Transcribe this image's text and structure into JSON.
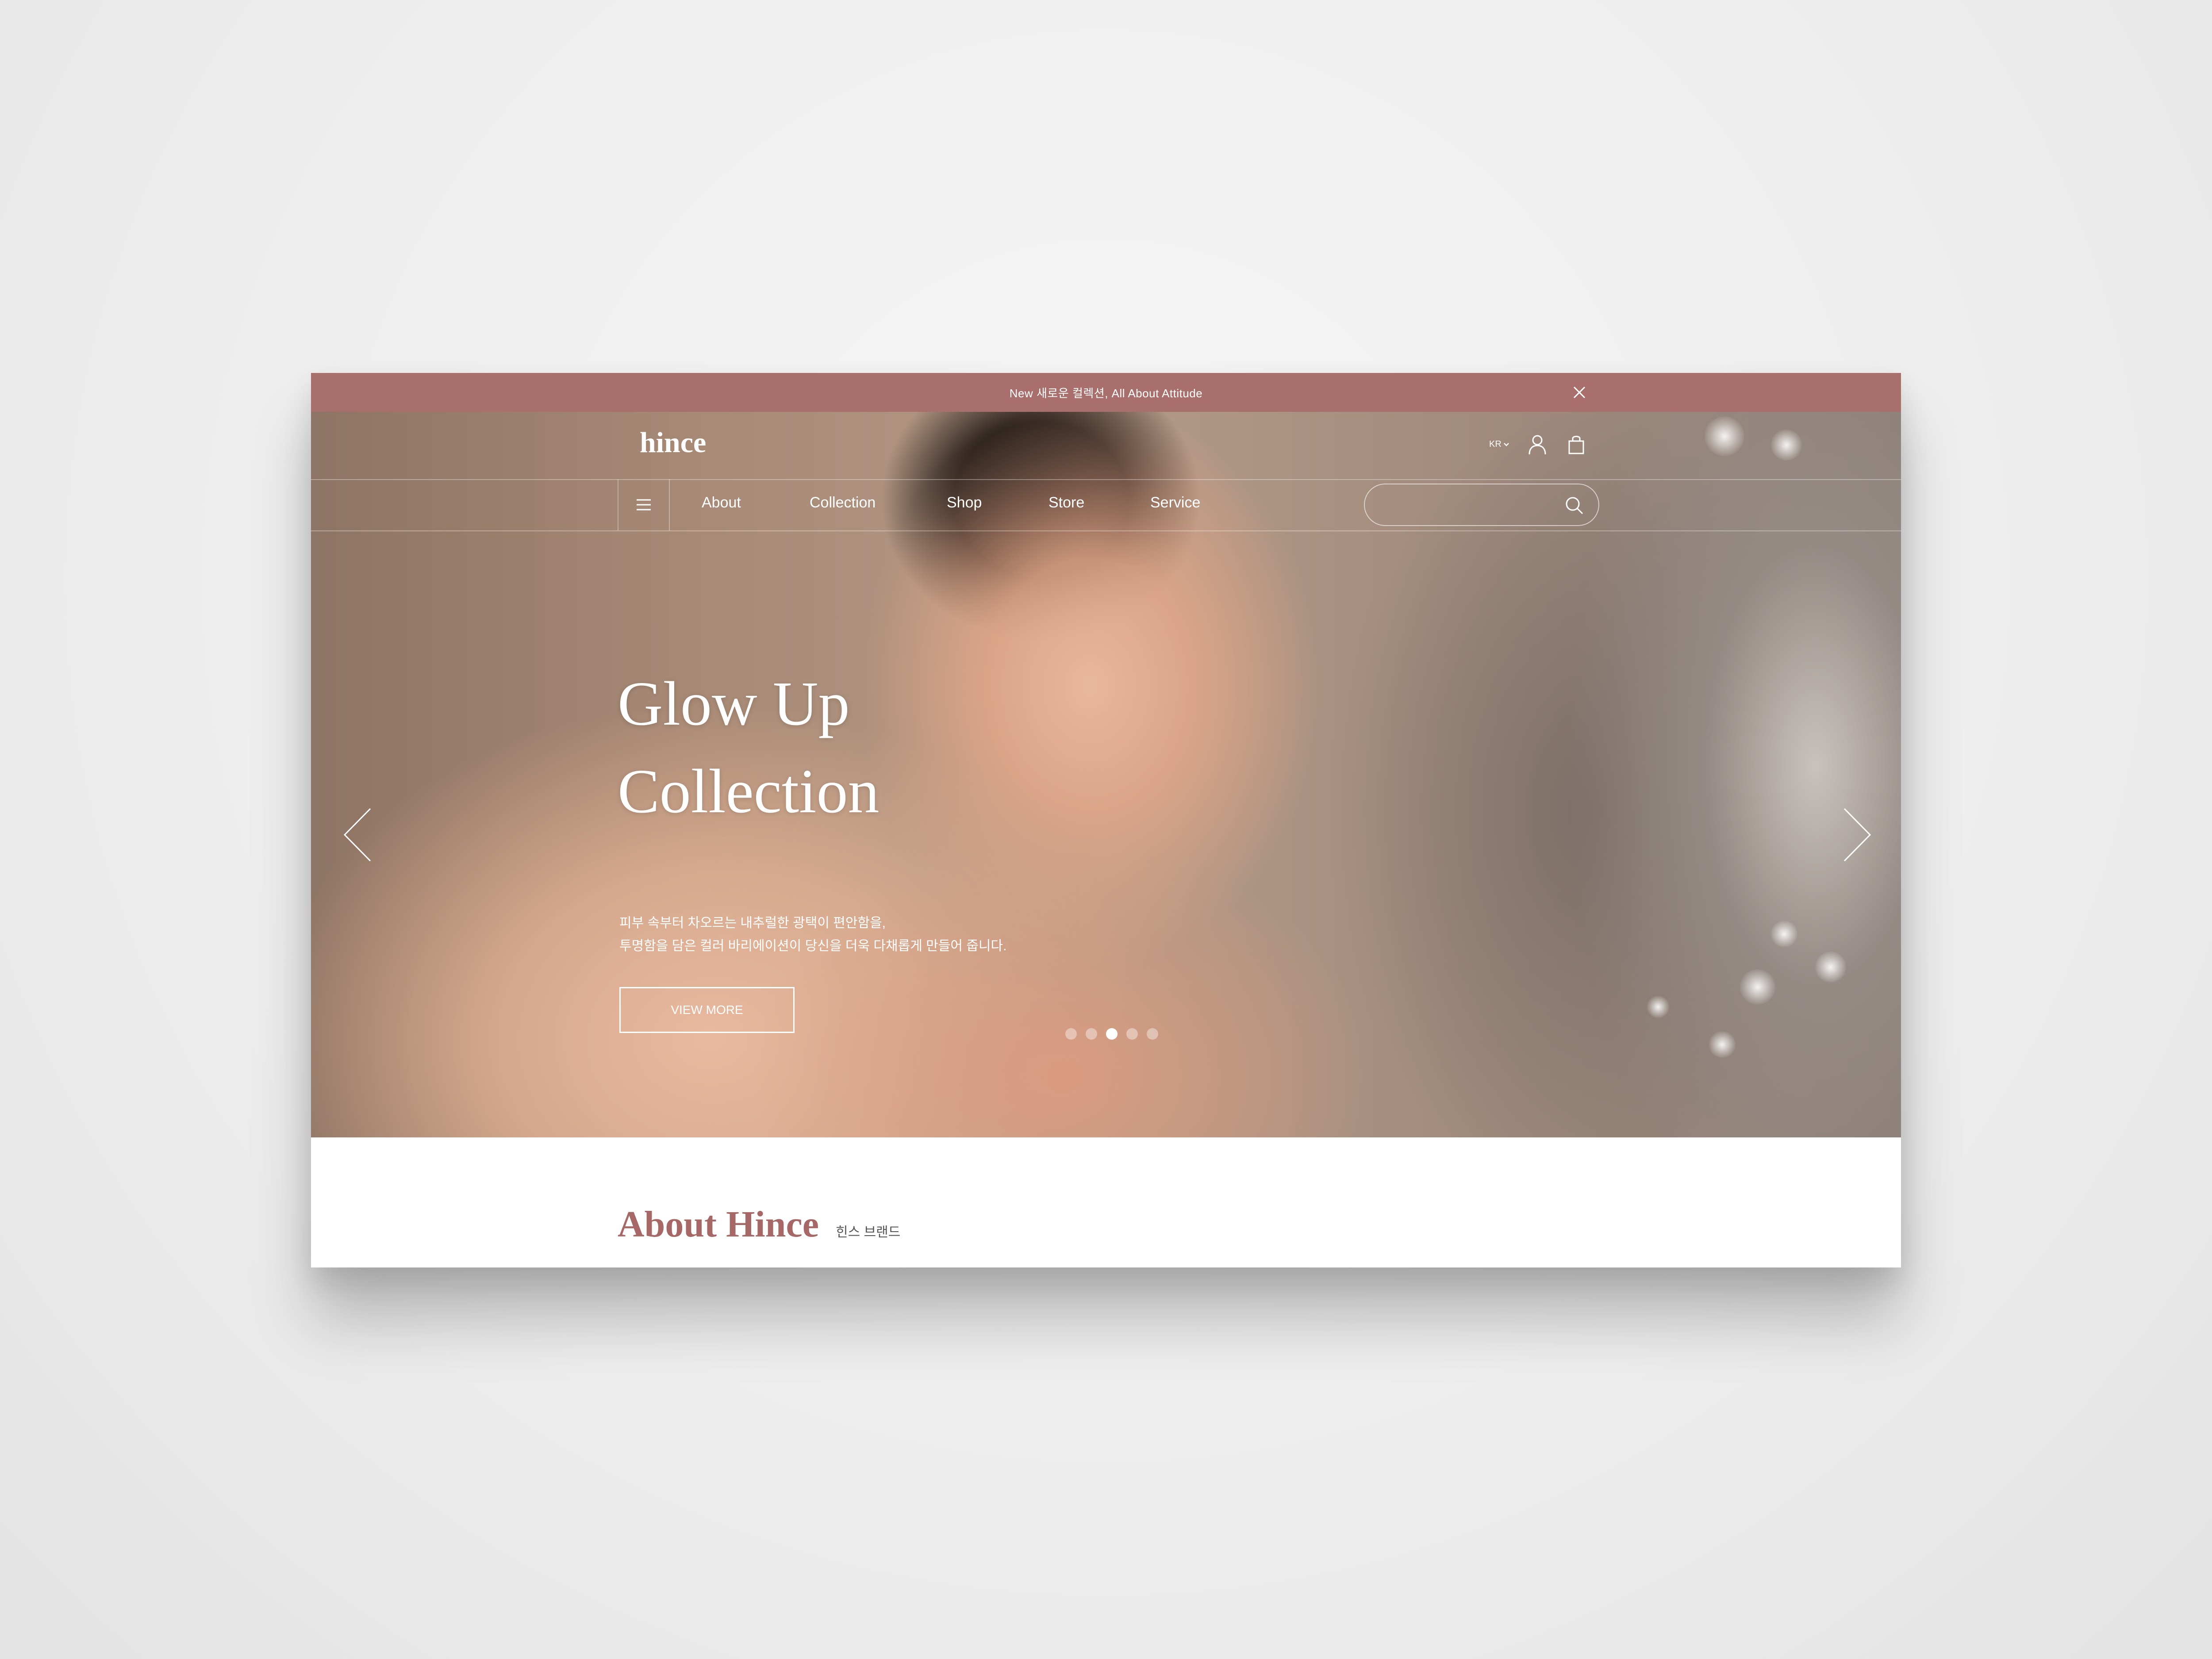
{
  "announcement": {
    "text": "New 새로운 컬렉션, All About Attitude"
  },
  "header": {
    "logo": "hince",
    "language": "KR",
    "search": {
      "placeholder": ""
    }
  },
  "nav": {
    "items": [
      {
        "label": "About"
      },
      {
        "label": "Collection"
      },
      {
        "label": "Shop"
      },
      {
        "label": "Store"
      },
      {
        "label": "Service"
      }
    ]
  },
  "hero": {
    "title_line1": "Glow Up",
    "title_line2": "Collection",
    "desc_line1": "피부 속부터 차오르는 내추럴한 광택이 편안함을,",
    "desc_line2": "투명함을 담은 컬러 바리에이션이 당신을 더욱 다채롭게 만들어 줍니다.",
    "button_label": "VIEW MORE",
    "slide_count": 5,
    "active_slide": 3
  },
  "about": {
    "title": "About Hince",
    "subtitle": "힌스 브랜드"
  },
  "colors": {
    "brand": "#a86f6c",
    "heading": "#a56866"
  },
  "icons": [
    "close-icon",
    "chevron-down-icon",
    "user-icon",
    "shopping-bag-icon",
    "menu-icon",
    "search-icon",
    "arrow-left-icon",
    "arrow-right-icon"
  ]
}
